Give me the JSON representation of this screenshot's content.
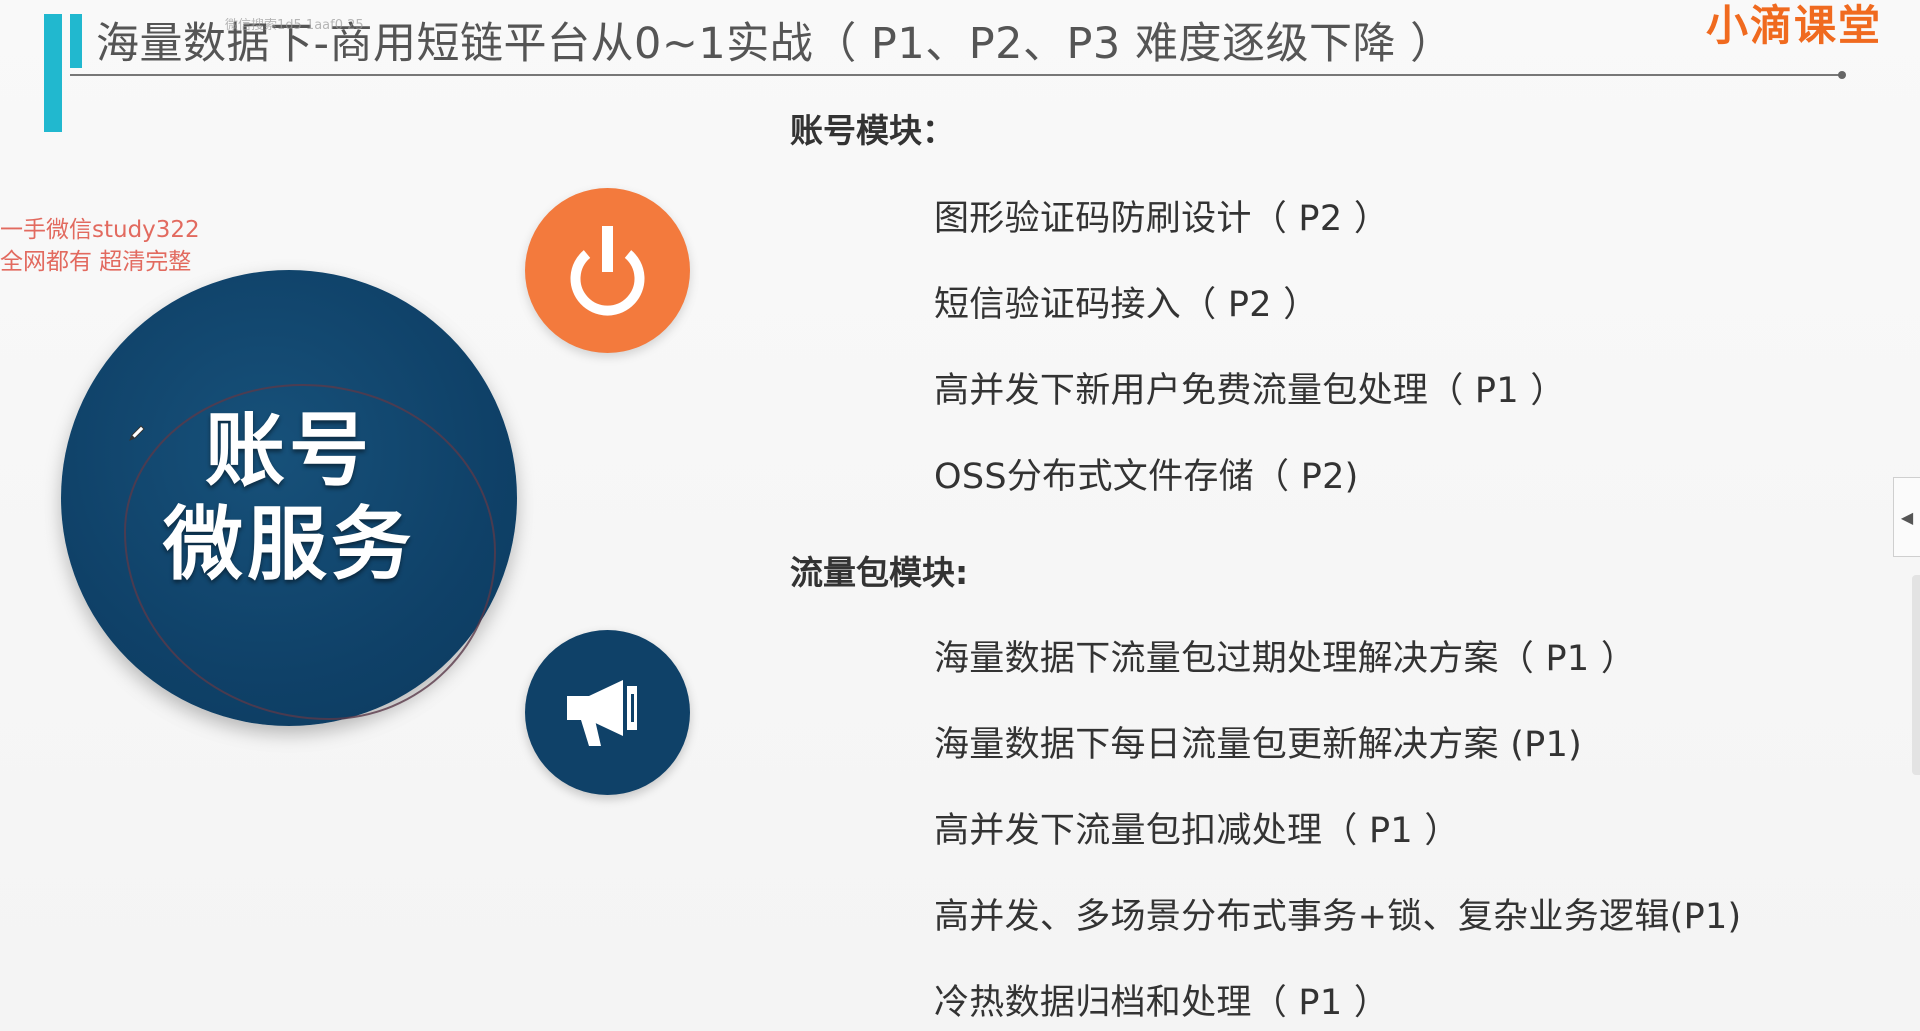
{
  "title": {
    "text": "海量数据下-商用短链平台从0~1实战（ P1、P2、P3 难度逐级下降 ）",
    "watermark": "微信搜索1d5 1aaf0 25"
  },
  "brand": {
    "logo_text": "小滴课堂",
    "accent_color": "#f06a1f"
  },
  "promo": {
    "line1": "一手微信study322",
    "line2": "全网都有 超清完整"
  },
  "graphic": {
    "circle_text_line1": "账号",
    "circle_text_line2": "微服务",
    "orange_color": "#f37a3d",
    "navy_color": "#0f4168",
    "top_icon": "power-icon",
    "bottom_icon": "megaphone-icon"
  },
  "sections": [
    {
      "heading": "账号模块：",
      "items": [
        "图形验证码防刷设计（ P2 ）",
        "短信验证码接入（ P2 ）",
        "高并发下新用户免费流量包处理（ P1 ）",
        "OSS分布式文件存储（ P2)"
      ]
    },
    {
      "heading": "流量包模块:",
      "items": [
        "海量数据下流量包过期处理解决方案（ P1 ）",
        "海量数据下每日流量包更新解决方案 (P1)",
        "高并发下流量包扣减处理（ P1 ）",
        "高并发、多场景分布式事务+锁、复杂业务逻辑(P1)",
        "冷热数据归档和处理（ P1 ）"
      ]
    }
  ],
  "side_panel": {
    "toggle_icon": "collapse-left-icon",
    "glyph": "◀"
  }
}
